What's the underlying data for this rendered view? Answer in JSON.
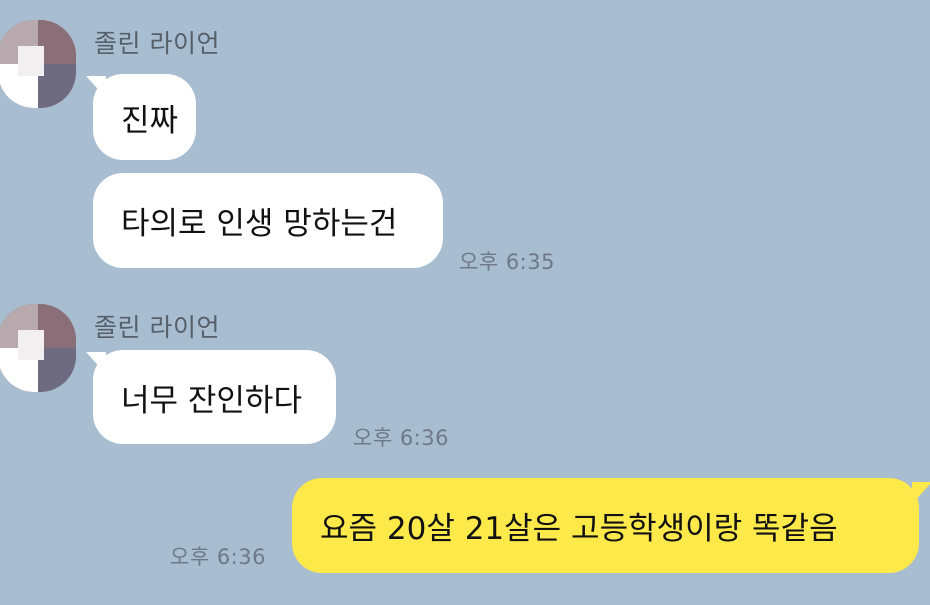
{
  "messages": [
    {
      "sender": "졸린 라이언",
      "bubbles": [
        "진짜",
        "타의로 인생 망하는건"
      ],
      "time": "오후 6:35"
    },
    {
      "sender": "졸린 라이언",
      "bubbles": [
        "너무 잔인하다"
      ],
      "time": "오후 6:36"
    },
    {
      "outgoing": true,
      "bubbles": [
        "요즘 20살 21살은 고등학생이랑 똑같음"
      ],
      "time": "오후 6:36"
    }
  ],
  "colors": {
    "background": "#a9bdd0",
    "incoming_bubble": "#ffffff",
    "outgoing_bubble": "#fee94a"
  }
}
